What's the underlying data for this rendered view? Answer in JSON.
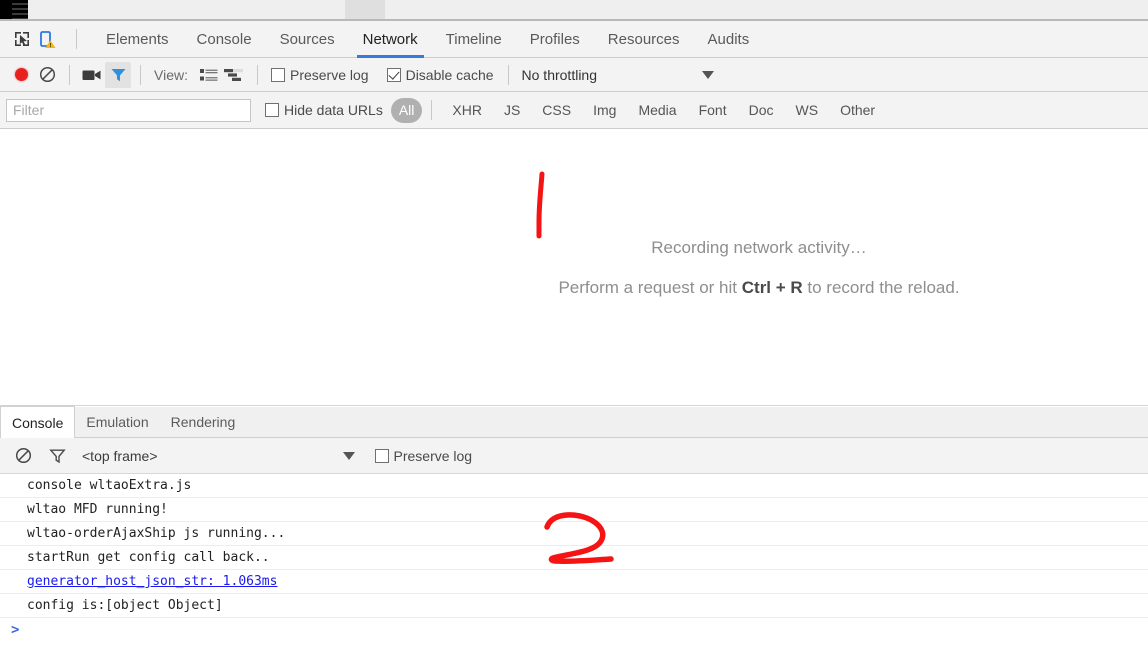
{
  "window": {
    "top_scrollbar": "scrollbar-thumb"
  },
  "devtools": {
    "toolbar_icons": [
      {
        "name": "inspect-element-icon",
        "title": "Select an element in the page to inspect it"
      },
      {
        "name": "device-toolbar-icon",
        "title": "Toggle device toolbar"
      }
    ],
    "tabs": [
      {
        "label": "Elements",
        "active": false
      },
      {
        "label": "Console",
        "active": false
      },
      {
        "label": "Sources",
        "active": false
      },
      {
        "label": "Network",
        "active": true
      },
      {
        "label": "Timeline",
        "active": false
      },
      {
        "label": "Profiles",
        "active": false
      },
      {
        "label": "Resources",
        "active": false
      },
      {
        "label": "Audits",
        "active": false
      }
    ],
    "active_tab": "Network",
    "accent_color": "#3879d9"
  },
  "network_toolbar": {
    "record_button": "record-button",
    "clear_button": "clear-button",
    "capture_screenshots_button": "camera-button",
    "filter_button": "filter-button",
    "filter_button_active": true,
    "view_label": "View:",
    "view_list_button": "list-view-icon",
    "view_waterfall_button": "waterfall-view-icon",
    "preserve_log": {
      "label": "Preserve log",
      "checked": false
    },
    "disable_cache": {
      "label": "Disable cache",
      "checked": true
    },
    "throttling": {
      "value": "No throttling"
    },
    "record_color": "#e82020"
  },
  "filter_bar": {
    "filter_input": {
      "value": "",
      "placeholder": "Filter"
    },
    "hide_data_urls": {
      "label": "Hide data URLs",
      "checked": false
    },
    "types": [
      {
        "label": "All",
        "selected": true
      },
      {
        "label": "XHR",
        "selected": false
      },
      {
        "label": "JS",
        "selected": false
      },
      {
        "label": "CSS",
        "selected": false
      },
      {
        "label": "Img",
        "selected": false
      },
      {
        "label": "Media",
        "selected": false
      },
      {
        "label": "Font",
        "selected": false
      },
      {
        "label": "Doc",
        "selected": false
      },
      {
        "label": "WS",
        "selected": false
      },
      {
        "label": "Other",
        "selected": false
      }
    ]
  },
  "network_panel": {
    "recording_message": "Recording network activity…",
    "hint_prefix": "Perform a request or hit ",
    "hint_shortcut": "Ctrl + R",
    "hint_suffix": " to record the reload."
  },
  "drawer": {
    "tabs": [
      {
        "label": "Console",
        "active": true
      },
      {
        "label": "Emulation",
        "active": false
      },
      {
        "label": "Rendering",
        "active": false
      }
    ],
    "toolbar": {
      "clear_console_button": "clear-console-icon",
      "filter_button": "console-filter-icon",
      "context_selector": "<top frame>",
      "preserve_log": {
        "label": "Preserve log",
        "checked": false
      }
    },
    "console_lines": [
      {
        "text": "console wltaoExtra.js",
        "style": "plain"
      },
      {
        "text": "wltao MFD running!",
        "style": "plain"
      },
      {
        "text": "wltao-orderAjaxShip js running...",
        "style": "plain"
      },
      {
        "text": "startRun get config call back..",
        "style": "plain"
      },
      {
        "text": "generator_host_json_str: 1.063ms",
        "style": "link"
      },
      {
        "text": "config is:[object Object]",
        "style": "plain"
      }
    ],
    "prompt": ">"
  },
  "annotations": [
    {
      "name": "red-mark-1",
      "label": "1",
      "color": "#f41414"
    },
    {
      "name": "red-mark-2",
      "label": "2",
      "color": "#f41414"
    }
  ]
}
